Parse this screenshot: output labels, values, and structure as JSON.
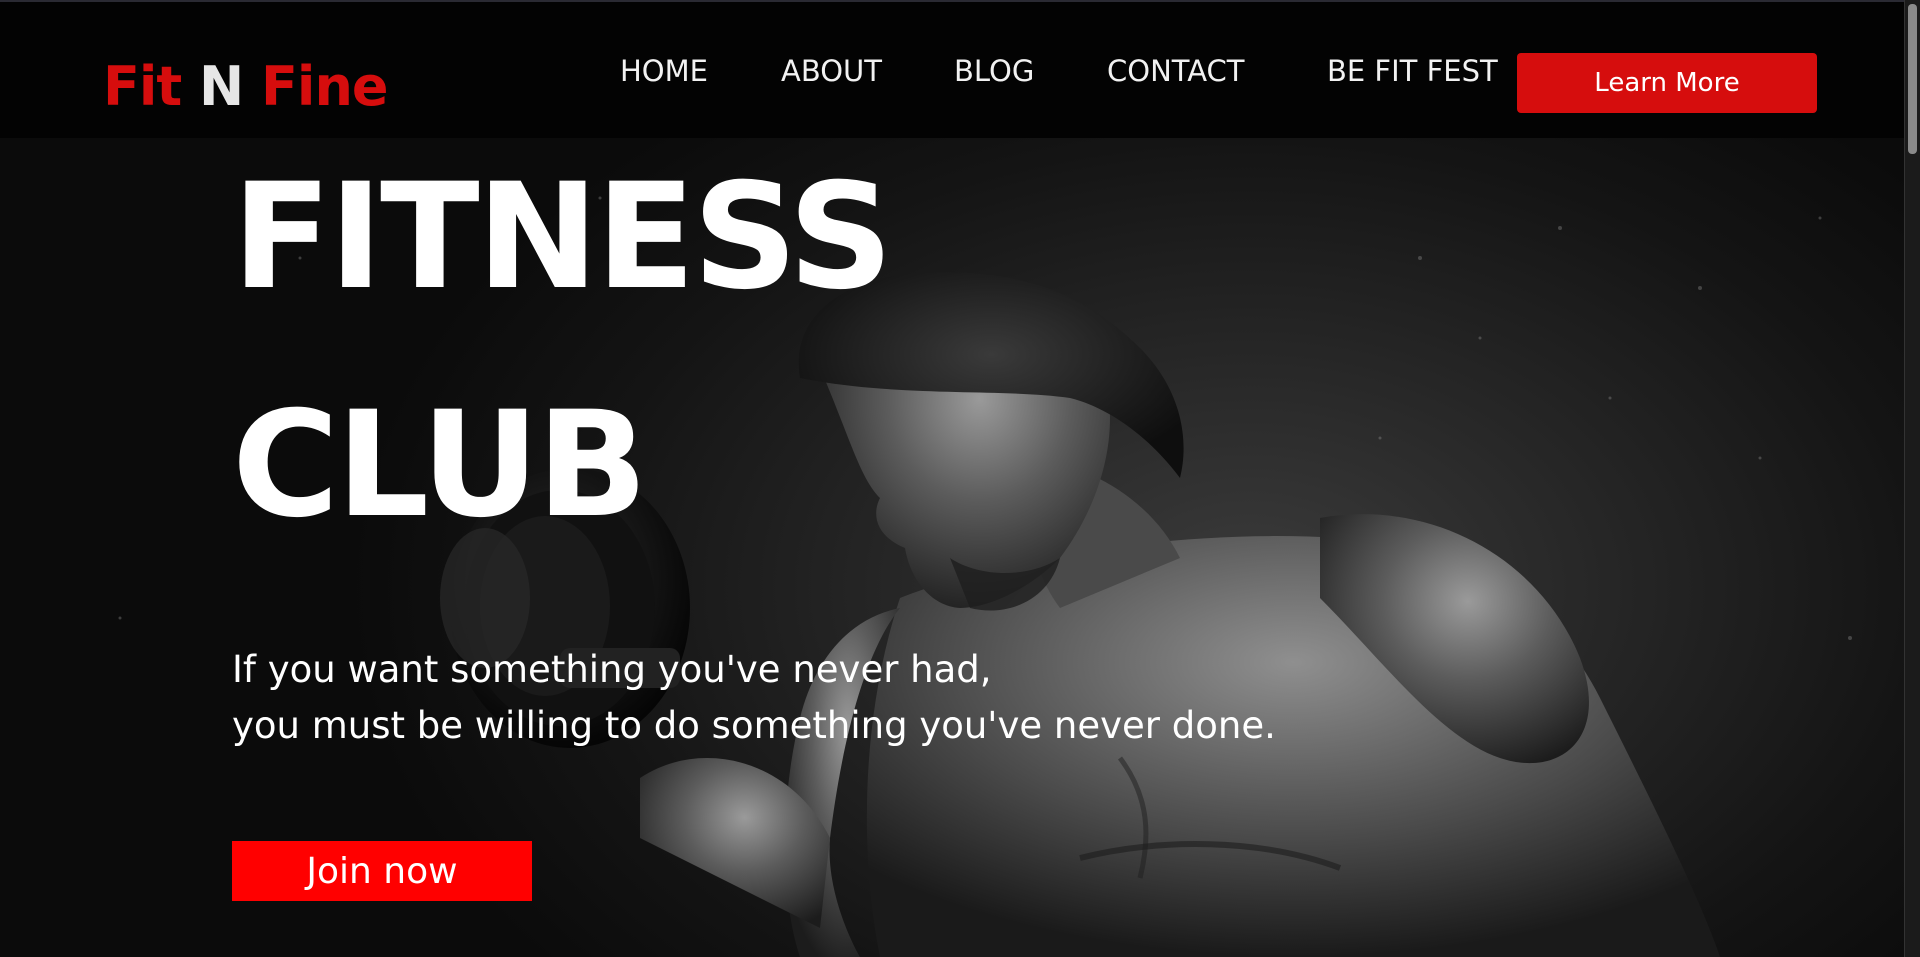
{
  "logo": {
    "part1": "Fit",
    "part2": "N",
    "part3": "Fine"
  },
  "nav": {
    "items": [
      {
        "label": "HOME"
      },
      {
        "label": "ABOUT"
      },
      {
        "label": "BLOG"
      },
      {
        "label": "CONTACT"
      },
      {
        "label": "BE FIT FEST"
      }
    ],
    "cta_label": "Learn More"
  },
  "hero": {
    "title_line1": "FITNESS",
    "title_line2": "CLUB",
    "tagline_line1": "If you want something you've never had,",
    "tagline_line2": "you must be willing to do something you've never done.",
    "join_label": "Join now"
  },
  "colors": {
    "brand_red": "#d60d0d",
    "button_red": "#ff0000",
    "navbar_bg": "#030303"
  }
}
